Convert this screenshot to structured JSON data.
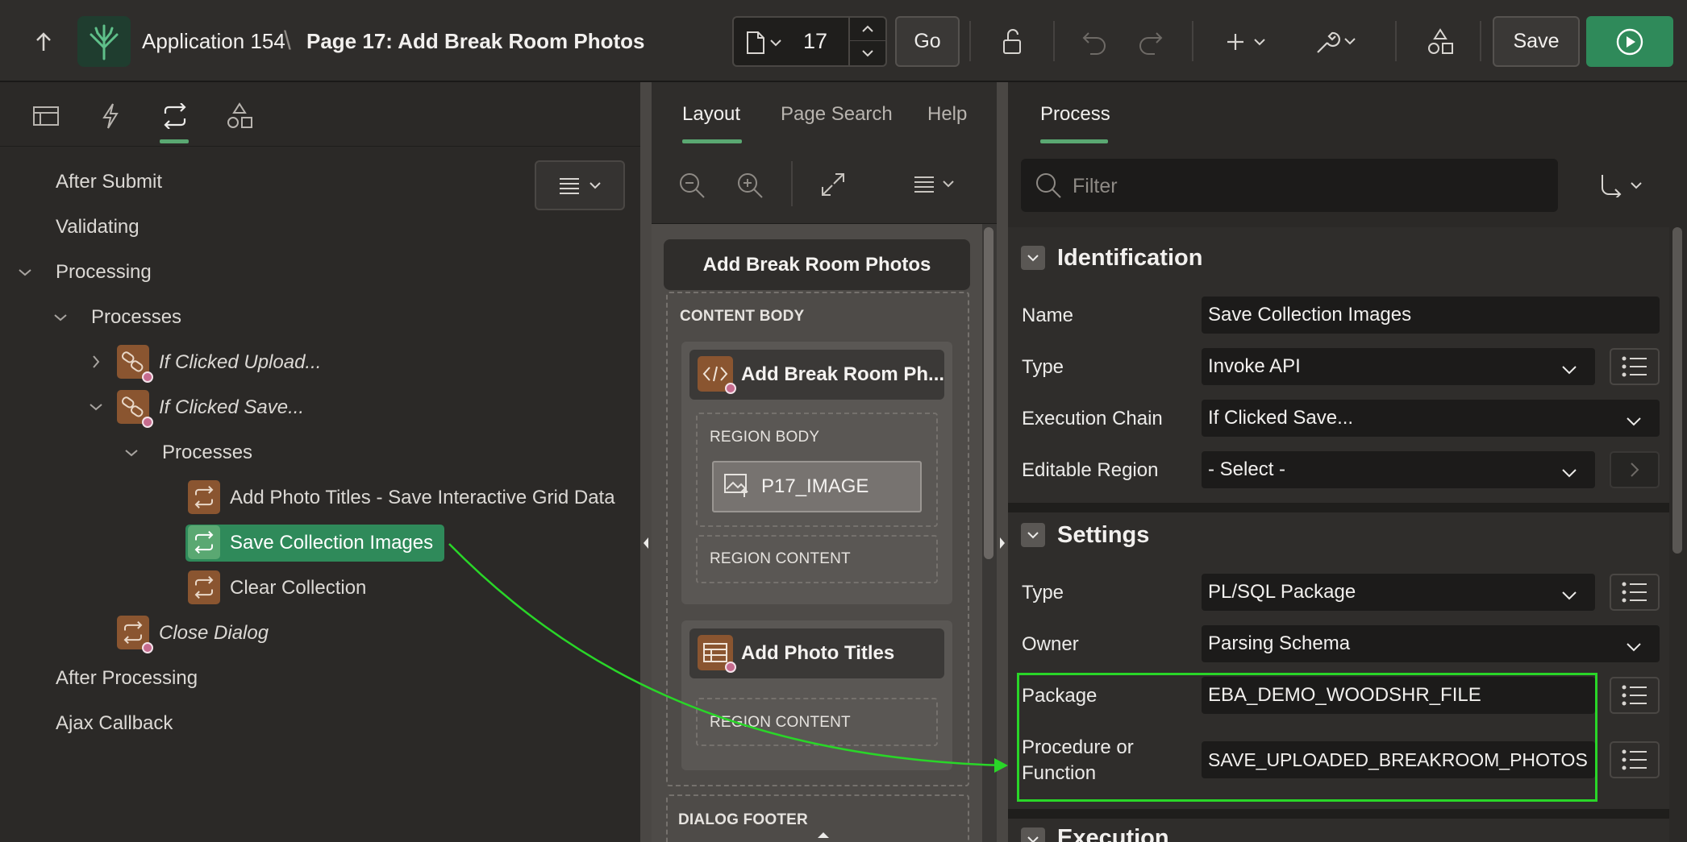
{
  "header": {
    "app_name": "Application 154",
    "separator": "\\",
    "page_title": "Page 17: Add Break Room Photos",
    "page_number": "17",
    "go_label": "Go",
    "save_label": "Save"
  },
  "left_tree": {
    "after_submit": "After Submit",
    "validating": "Validating",
    "processing": "Processing",
    "processes": "Processes",
    "if_clicked_upload": "If Clicked Upload...",
    "if_clicked_save": "If Clicked Save...",
    "sub_processes": "Processes",
    "add_photo_titles": "Add Photo Titles - Save Interactive Grid Data",
    "save_collection_images": "Save Collection Images",
    "clear_collection": "Clear Collection",
    "close_dialog": "Close Dialog",
    "after_processing": "After Processing",
    "ajax_callback": "Ajax Callback"
  },
  "middle": {
    "tabs": [
      "Layout",
      "Page Search",
      "Help"
    ],
    "dialog_title": "Add Break Room Photos",
    "content_body": "CONTENT BODY",
    "region1_title": "Add Break Room Ph...",
    "region_body": "REGION BODY",
    "item_name": "P17_IMAGE",
    "region_content": "REGION CONTENT",
    "region2_title": "Add Photo Titles",
    "region_content2": "REGION CONTENT",
    "dialog_footer": "DIALOG FOOTER"
  },
  "right": {
    "tab": "Process",
    "filter_placeholder": "Filter",
    "identification": {
      "title": "Identification",
      "name_label": "Name",
      "name_value": "Save Collection Images",
      "type_label": "Type",
      "type_value": "Invoke API",
      "chain_label": "Execution Chain",
      "chain_value": "If Clicked Save...",
      "editable_label": "Editable Region",
      "editable_value": "- Select -"
    },
    "settings": {
      "title": "Settings",
      "type_label": "Type",
      "type_value": "PL/SQL Package",
      "owner_label": "Owner",
      "owner_value": "Parsing Schema",
      "package_label": "Package",
      "package_value": "EBA_DEMO_WOODSHR_FILE",
      "procedure_label_1": "Procedure or",
      "procedure_label_2": "Function",
      "procedure_value": "SAVE_UPLOADED_BREAKROOM_PHOTOS"
    },
    "execution": {
      "title": "Execution"
    }
  },
  "colors": {
    "accent_green": "#2f8a5a",
    "annotation_green": "#29d628",
    "process_icon_brown": "#8a5530"
  }
}
